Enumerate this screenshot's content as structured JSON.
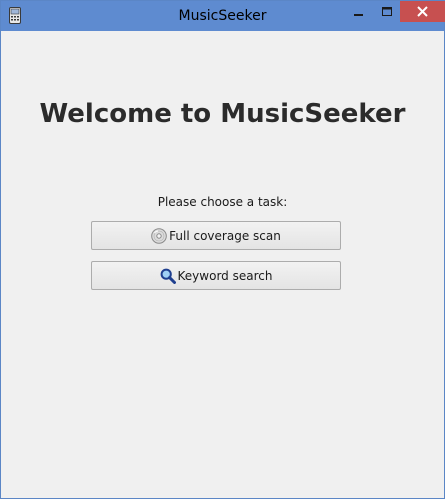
{
  "window": {
    "title": "MusicSeeker",
    "titlebar_color": "#5e8bd0",
    "close_button_color": "#c75050"
  },
  "icons": {
    "app": "phone-app-icon",
    "minimize": "minimize-icon",
    "maximize": "maximize-icon",
    "close": "close-icon",
    "scan": "cd-disc-icon",
    "search": "magnifier-icon"
  },
  "main": {
    "heading": "Welcome to MusicSeeker",
    "prompt": "Please choose a task:",
    "buttons": {
      "scan_label": "Full coverage scan",
      "keyword_label": "Keyword search"
    }
  }
}
